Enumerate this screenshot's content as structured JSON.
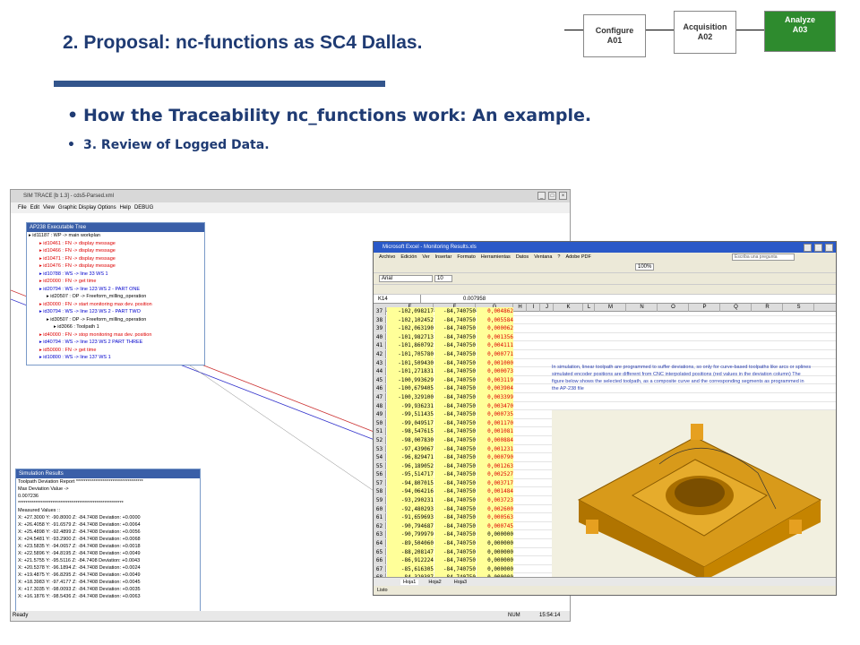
{
  "slide": {
    "title": "2. Proposal: nc-functions as SC4 Dallas.",
    "bullet1": "How the Traceability nc_functions work: An example.",
    "bullet2": "3. Review of Logged Data."
  },
  "flow": {
    "configure": "Configure",
    "configure_id": "A01",
    "acquisition": "Acquisition",
    "acquisition_id": "A02",
    "analyze": "Analyze",
    "analyze_id": "A03",
    "analyze_color": "#2e8b2e"
  },
  "simtrace": {
    "title": "SIM TRACE [b 1.3] - cds5-Parsed.xml",
    "menu": [
      "File",
      "Edit",
      "View",
      "Graphic Display Options",
      "Help",
      "DEBUG"
    ],
    "tree_title": "AP238 Executable Tree",
    "tree": [
      {
        "text": "id11187 : WP -> main workplan",
        "cls": "blk"
      },
      {
        "text": "id10461 : FN -> display message",
        "cls": "red"
      },
      {
        "text": "id10466 : FN -> display message",
        "cls": "red"
      },
      {
        "text": "id10471 : FN -> display message",
        "cls": "red"
      },
      {
        "text": "id10476 : FN -> display message",
        "cls": "red"
      },
      {
        "text": "id10788 : WS -> line 33 WS 1",
        "cls": "blue"
      },
      {
        "text": "id20000 : FN -> get time",
        "cls": "red"
      },
      {
        "text": "id20794 : WS -> line 123 WS 2 - PART ONE",
        "cls": "blue"
      },
      {
        "text": "id20507 : OP -> Freeform_milling_operation",
        "cls": "blk"
      },
      {
        "text": "id30000 : FN -> start monitoring max dev. position",
        "cls": "red"
      },
      {
        "text": "id30794 : WS -> line 123 WS 2 - PART TWO",
        "cls": "blue"
      },
      {
        "text": "id30507 : OP -> Freeform_milling_operation",
        "cls": "blk"
      },
      {
        "text": "id3066 : Toolpath 1",
        "cls": "blk"
      },
      {
        "text": "id40000 : FN -> stop monitoring max dev. position",
        "cls": "red"
      },
      {
        "text": "id40794 : WS -> line 123 WS 2 PART THREE",
        "cls": "blue"
      },
      {
        "text": "id50000 : FN -> get time",
        "cls": "red"
      },
      {
        "text": "id10800 : WS -> line 137 WS 1",
        "cls": "blue"
      }
    ],
    "results_title": "Simulation Results",
    "results": [
      "Toolpath Deviation Report ***********************************",
      "Max Deviation Value ->",
      "0.007236",
      "*******************************************************",
      "Measured Values ::",
      "X: +27.3000  Y: -90.8000  Z: -84.7408  Deviation: +0.0000",
      "X: +26.4058  Y: -91.6579  Z: -84.7408  Deviation: +0.0064",
      "X: +25.4898  Y: -92.4899  Z: -84.7408  Deviation: +0.0056",
      "X: +24.5481  Y: -93.2900  Z: -84.7408  Deviation: +0.0068",
      "X: +23.5835  Y: -94.0657  Z: -84.7408  Deviation: +0.0018",
      "X: +22.5896  Y: -94.8195  Z: -84.7408  Deviation: +0.0049",
      "X: +21.5755  Y: -95.5116  Z: -84.7408  Deviation: +0.0043",
      "X: +20.5378  Y: -96.1894  Z: -84.7408  Deviation: +0.0024",
      "X: +19.4875  Y: -96.8295  Z: -84.7408  Deviation: +0.0049",
      "X: +18.3983  Y: -97.4177  Z: -84.7408  Deviation: +0.0045",
      "X: +17.3035  Y: -98.0093  Z: -84.7408  Deviation: +0.0035",
      "X: +16.1876  Y: -98.5436  Z: -84.7408  Deviation: +0.0063"
    ],
    "status_left": "Ready",
    "status_num": "NUM",
    "status_time": "15:54:14"
  },
  "excel": {
    "title": "Microsoft Excel - Monitoring Results.xls",
    "menu": [
      "Archivo",
      "Edición",
      "Ver",
      "Insertar",
      "Formato",
      "Herramientas",
      "Datos",
      "Ventana",
      "?",
      "Adobe PDF"
    ],
    "help_placeholder": "Escriba una pregunta",
    "font": "Arial",
    "font_size": "10",
    "zoom": "100%",
    "namebox": "K14",
    "formula": "0.007958",
    "columns": [
      "E",
      "F",
      "G",
      "H",
      "I",
      "J",
      "K",
      "L",
      "M",
      "N",
      "O",
      "P",
      "Q",
      "R",
      "S"
    ],
    "rows": [
      {
        "n": "37",
        "e": "-102,098217",
        "f": "-84,740750",
        "g": "0,004862"
      },
      {
        "n": "38",
        "e": "-102,102452",
        "f": "-84,740750",
        "g": "0,005584"
      },
      {
        "n": "39",
        "e": "-102,063190",
        "f": "-84,740750",
        "g": "0,000062"
      },
      {
        "n": "40",
        "e": "-101,982713",
        "f": "-84,740750",
        "g": "0,001356"
      },
      {
        "n": "41",
        "e": "-101,860792",
        "f": "-84,740750",
        "g": "0,004111"
      },
      {
        "n": "42",
        "e": "-101,705780",
        "f": "-84,740750",
        "g": "0,000771"
      },
      {
        "n": "43",
        "e": "-101,509430",
        "f": "-84,740750",
        "g": "0,001000"
      },
      {
        "n": "44",
        "e": "-101,271831",
        "f": "-84,740750",
        "g": "0,000073"
      },
      {
        "n": "45",
        "e": "-100,993629",
        "f": "-84,740750",
        "g": "0,003119"
      },
      {
        "n": "46",
        "e": "-100,679405",
        "f": "-84,740750",
        "g": "0,003904"
      },
      {
        "n": "47",
        "e": "-100,329100",
        "f": "-84,740750",
        "g": "0,003399"
      },
      {
        "n": "48",
        "e": "-99,936231",
        "f": "-84,740750",
        "g": "0,003470"
      },
      {
        "n": "49",
        "e": "-99,511435",
        "f": "-84,740750",
        "g": "0,000735"
      },
      {
        "n": "50",
        "e": "-99,049517",
        "f": "-84,740750",
        "g": "0,001170"
      },
      {
        "n": "51",
        "e": "-98,547615",
        "f": "-84,740750",
        "g": "0,001081"
      },
      {
        "n": "52",
        "e": "-98,007830",
        "f": "-84,740750",
        "g": "0,000884"
      },
      {
        "n": "53",
        "e": "-97,439067",
        "f": "-84,740750",
        "g": "0,001231"
      },
      {
        "n": "54",
        "e": "-96,829471",
        "f": "-84,740750",
        "g": "0,000790"
      },
      {
        "n": "55",
        "e": "-96,189052",
        "f": "-84,740750",
        "g": "0,001263"
      },
      {
        "n": "56",
        "e": "-95,514717",
        "f": "-84,740750",
        "g": "0,002527"
      },
      {
        "n": "57",
        "e": "-94,807015",
        "f": "-84,740750",
        "g": "0,003717"
      },
      {
        "n": "58",
        "e": "-94,064216",
        "f": "-84,740750",
        "g": "0,001484"
      },
      {
        "n": "59",
        "e": "-93,290231",
        "f": "-84,740750",
        "g": "0,003723"
      },
      {
        "n": "60",
        "e": "-92,480293",
        "f": "-84,740750",
        "g": "0,002600"
      },
      {
        "n": "61",
        "e": "-91,659693",
        "f": "-84,740750",
        "g": "0,000563"
      },
      {
        "n": "62",
        "e": "-90,794687",
        "f": "-84,740750",
        "g": "0,000745"
      },
      {
        "n": "63",
        "e": "-90,799979",
        "f": "-84,740750",
        "g": "0,000000"
      },
      {
        "n": "64",
        "e": "-89,504060",
        "f": "-84,740750",
        "g": "0,000000"
      },
      {
        "n": "65",
        "e": "-88,208147",
        "f": "-84,740750",
        "g": "0,000000"
      },
      {
        "n": "66",
        "e": "-86,912224",
        "f": "-84,740750",
        "g": "0,000000"
      },
      {
        "n": "67",
        "e": "-85,616305",
        "f": "-84,740750",
        "g": "0,000000"
      },
      {
        "n": "68",
        "e": "-84,320387",
        "f": "-84,740750",
        "g": "0,000000"
      }
    ],
    "note": "In simulation, linear toolpath are programmed to suffer deviations, so only for curve-based toolpaths like arcs or splines simulated encoder positions are different from CNC interpolated positions (red values in the deviation column) The figure below shows the selected toolpath, as a composite curve and the corresponding segments as programmed in the AP-238 file",
    "tabs": [
      "Hoja1",
      "Hoja2",
      "Hoja3"
    ],
    "status": "Listo"
  }
}
